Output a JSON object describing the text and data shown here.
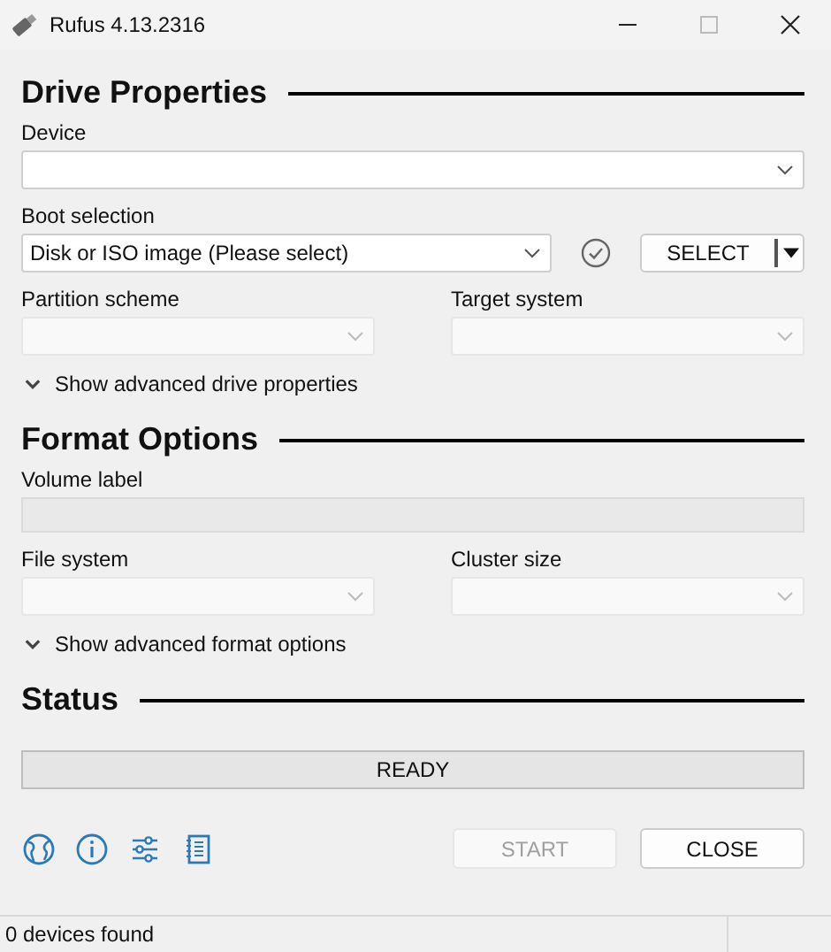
{
  "window": {
    "title": "Rufus 4.13.2316"
  },
  "sections": [
    {
      "heading": "Drive Properties",
      "rows": [
        {
          "kind": "full",
          "fields": [
            {
              "label": "Device",
              "disabled": false
            }
          ]
        },
        {
          "kind": "boot",
          "fields": [
            {
              "label": "Boot selection",
              "value": "Disk or ISO image (Please select)",
              "disabled": false
            }
          ],
          "button": "SELECT"
        },
        {
          "kind": "half",
          "fields": [
            {
              "label": "Partition scheme",
              "disabled": true
            },
            {
              "label": "Target system",
              "disabled": true
            }
          ]
        }
      ],
      "toggle": {
        "label": "Show advanced drive properties",
        "expanded": false
      }
    },
    {
      "heading": "Format Options",
      "rows": [
        {
          "kind": "text",
          "fields": [
            {
              "label": "Volume label",
              "disabled": true
            }
          ]
        },
        {
          "kind": "half",
          "fields": [
            {
              "label": "File system",
              "disabled": true
            },
            {
              "label": "Cluster size",
              "disabled": true
            }
          ]
        }
      ],
      "toggle": {
        "label": "Show advanced format options",
        "expanded": false
      }
    },
    {
      "heading": "Status",
      "progress": {
        "text": "READY"
      }
    }
  ],
  "buttons": [
    {
      "label": "START",
      "disabled": true
    },
    {
      "label": "CLOSE",
      "disabled": false
    }
  ],
  "status_bar": {
    "text": "0 devices found"
  }
}
